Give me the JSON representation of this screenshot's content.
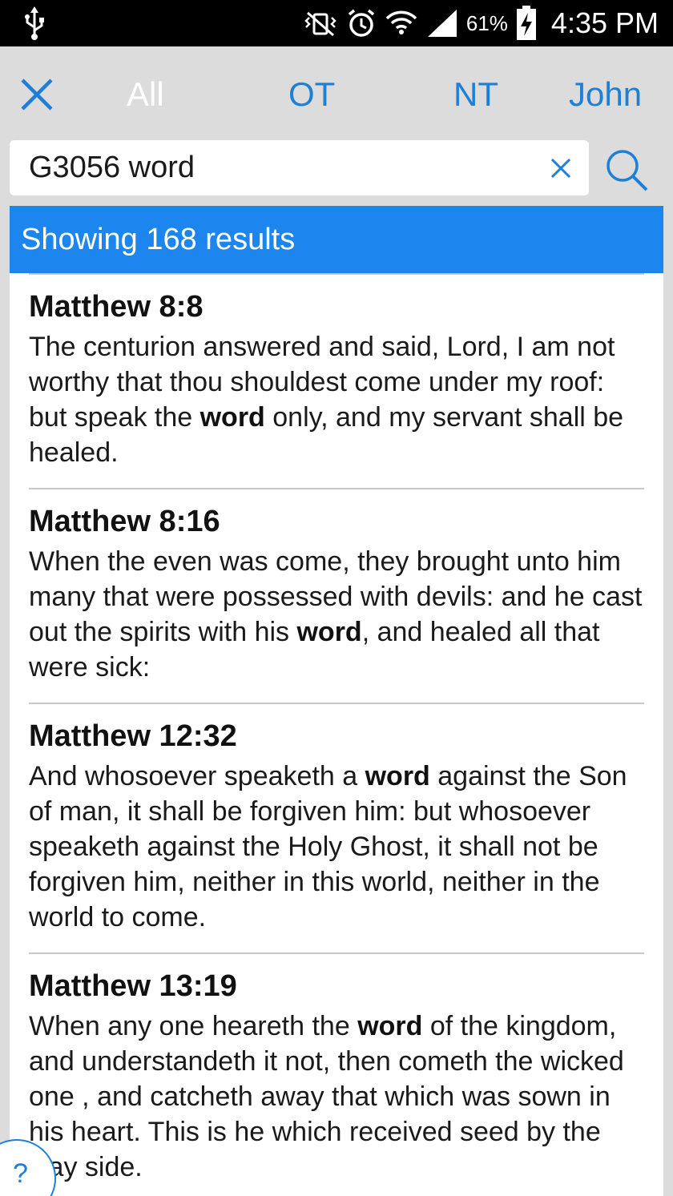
{
  "status_bar": {
    "battery_percent": "61%",
    "time": "4:35 PM"
  },
  "filter_tabs": [
    {
      "label": "All",
      "active": true
    },
    {
      "label": "OT",
      "active": false
    },
    {
      "label": "NT",
      "active": false
    },
    {
      "label": "John",
      "active": false
    }
  ],
  "search": {
    "value": "G3056 word"
  },
  "results_banner": "Showing 168 results",
  "results": [
    {
      "reference": "Matthew 8:8",
      "before": "The centurion answered and said, Lord, I am not worthy that thou shouldest come under my roof: but speak the ",
      "highlight": "word",
      "after": " only, and my servant shall be healed."
    },
    {
      "reference": "Matthew 8:16",
      "before": "When the even was come, they brought unto him many that were possessed with devils: and he cast out the spirits with his ",
      "highlight": "word",
      "after": ", and healed all that were sick:"
    },
    {
      "reference": "Matthew 12:32",
      "before": "And whosoever speaketh a ",
      "highlight": "word",
      "after": " against the Son of man, it shall be forgiven him: but whosoever speaketh against the Holy Ghost, it shall not be forgiven him, neither in this world, neither in the world to come."
    },
    {
      "reference": "Matthew 13:19",
      "before": "When any one heareth the ",
      "highlight": "word",
      "after": " of the kingdom, and understandeth it not, then cometh the wicked one , and catcheth away that which was sown in his heart. This is he which received seed by the way side."
    }
  ],
  "help_label": "?",
  "colors": {
    "accent": "#1c86ee",
    "link_blue": "#1e7fd6",
    "background": "#dcdcdc"
  }
}
